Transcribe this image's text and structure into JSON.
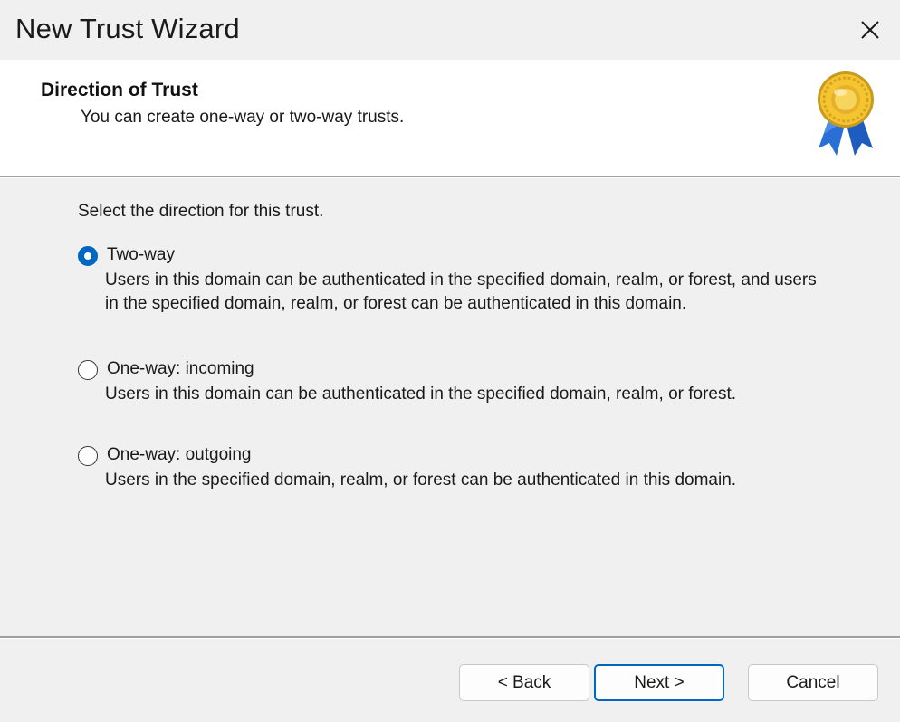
{
  "window": {
    "title": "New Trust Wizard",
    "close_icon": "close-icon"
  },
  "header": {
    "title": "Direction of Trust",
    "subtitle": "You can create one-way or two-way trusts.",
    "icon": "award-ribbon-icon"
  },
  "body": {
    "prompt": "Select the direction for this trust.",
    "options": [
      {
        "label": "Two-way",
        "description": "Users in this domain can be authenticated in the specified domain, realm, or forest, and users in the specified domain, realm, or forest can be authenticated in this domain.",
        "selected": true
      },
      {
        "label": "One-way: incoming",
        "description": "Users in this domain can be authenticated in the specified domain, realm, or forest.",
        "selected": false
      },
      {
        "label": "One-way: outgoing",
        "description": "Users in the specified domain, realm, or forest can be authenticated in this domain.",
        "selected": false
      }
    ]
  },
  "footer": {
    "back_label": "< Back",
    "next_label": "Next >",
    "cancel_label": "Cancel"
  },
  "colors": {
    "accent": "#0067c0",
    "background": "#f0f0f0",
    "header_background": "#ffffff"
  }
}
